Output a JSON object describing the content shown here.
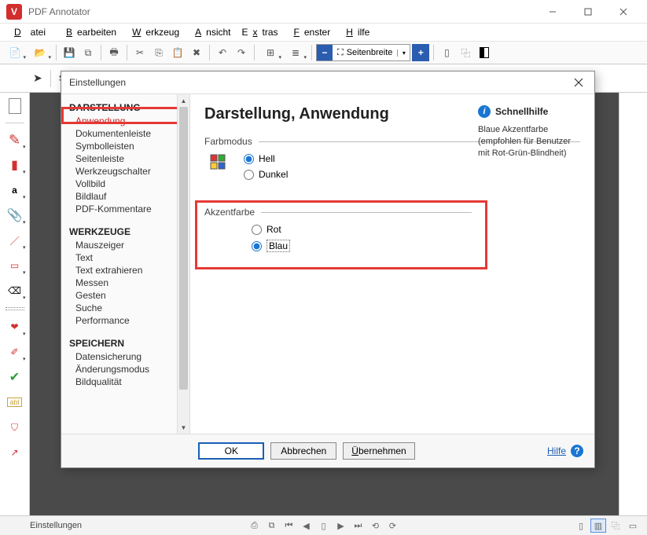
{
  "window": {
    "title": "PDF Annotator"
  },
  "menubar": [
    "Datei",
    "Bearbeiten",
    "Werkzeug",
    "Ansicht",
    "Extras",
    "Fenster",
    "Hilfe"
  ],
  "zoom": {
    "label": "Seitenbreite"
  },
  "toolrow": {
    "label": "Stift"
  },
  "dialog": {
    "title": "Einstellungen",
    "nav": {
      "sections": [
        {
          "header": "DARSTELLUNG",
          "items": [
            "Anwendung",
            "Dokumentenleiste",
            "Symbolleisten",
            "Seitenleiste",
            "Werkzeugschalter",
            "Vollbild",
            "Bildlauf",
            "PDF-Kommentare"
          ]
        },
        {
          "header": "WERKZEUGE",
          "items": [
            "Mauszeiger",
            "Text",
            "Text extrahieren",
            "Messen",
            "Gesten",
            "Suche",
            "Performance"
          ]
        },
        {
          "header": "SPEICHERN",
          "items": [
            "Datensicherung",
            "Änderungsmodus",
            "Bildqualität"
          ]
        }
      ],
      "selected": "Anwendung"
    },
    "content": {
      "heading": "Darstellung, Anwendung",
      "farbmodus": {
        "label": "Farbmodus",
        "options": [
          "Hell",
          "Dunkel"
        ],
        "selected": "Hell"
      },
      "akzentfarbe": {
        "label": "Akzentfarbe",
        "options": [
          "Rot",
          "Blau"
        ],
        "selected": "Blau"
      }
    },
    "side": {
      "title": "Schnellhilfe",
      "desc": "Blaue Akzentfarbe (empfohlen für Benutzer mit Rot-Grün-Blindheit)"
    },
    "buttons": {
      "ok": "OK",
      "cancel": "Abbrechen",
      "apply": "Übernehmen",
      "help": "Hilfe"
    }
  },
  "statusbar": {
    "text": "Einstellungen"
  }
}
